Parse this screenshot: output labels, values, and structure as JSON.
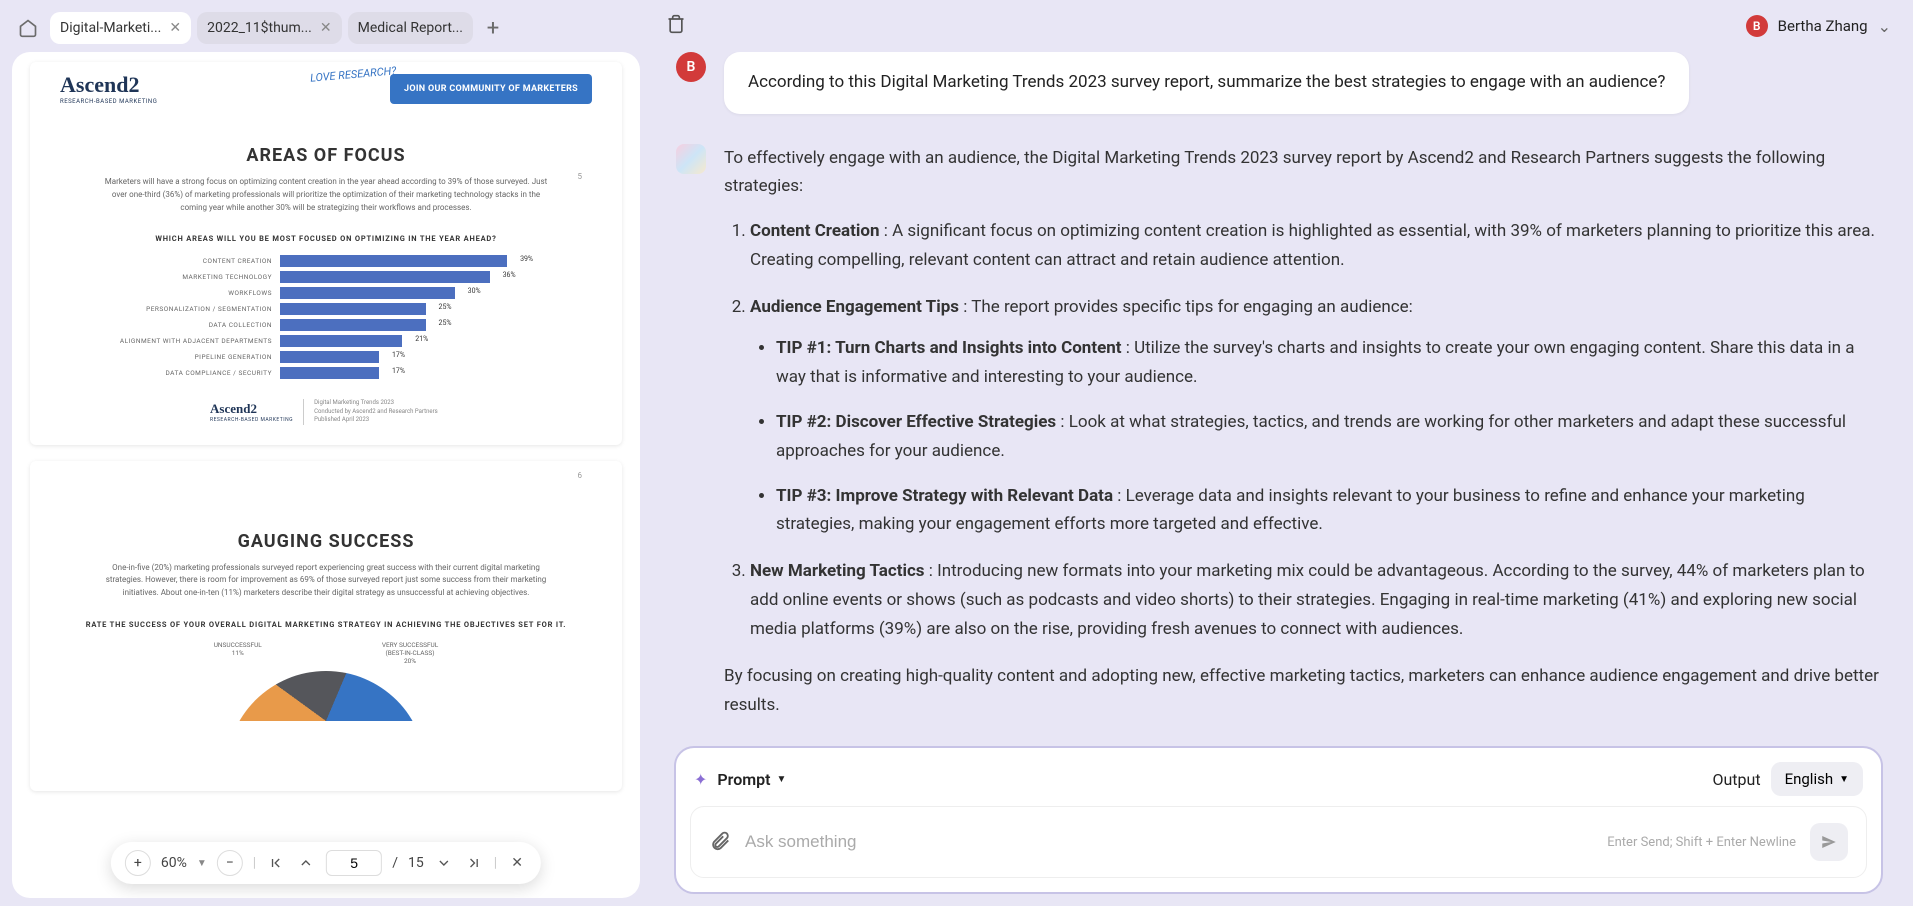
{
  "tabs": [
    {
      "label": "Digital-Marketi...",
      "active": true
    },
    {
      "label": "2022_11$thum...",
      "active": false
    },
    {
      "label": "Medical Report...",
      "active": false
    }
  ],
  "doc": {
    "logo": "Ascend2",
    "logo_sub": "RESEARCH-BASED MARKETING",
    "love": "LOVE RESEARCH?",
    "cta": "JOIN OUR COMMUNITY OF MARKETERS",
    "page5": {
      "num": "5",
      "title": "AREAS OF FOCUS",
      "text": "Marketers will have a strong focus on optimizing content creation in the year ahead according to 39% of those surveyed. Just over one-third (36%) of marketing professionals will prioritize the optimization of their marketing technology stacks in the coming year while another 30% will be strategizing their workflows and processes.",
      "chart_title": "WHICH AREAS WILL YOU BE MOST FOCUSED ON OPTIMIZING IN THE YEAR AHEAD?",
      "footer_lines": [
        "Digital Marketing Trends 2023",
        "Conducted by Ascend2 and Research Partners",
        "Published April 2023"
      ]
    },
    "page6": {
      "num": "6",
      "title": "GAUGING SUCCESS",
      "text": "One-in-five (20%) marketing professionals surveyed report experiencing great success with their current digital marketing strategies. However, there is room for improvement as 69% of those surveyed report just some success from their marketing initiatives. About one-in-ten (11%) marketers describe their digital strategy as unsuccessful at achieving objectives.",
      "chart_title": "RATE THE SUCCESS OF YOUR OVERALL DIGITAL MARKETING STRATEGY IN ACHIEVING THE OBJECTIVES SET FOR IT.",
      "donut_left": "UNSUCCESSFUL\n11%",
      "donut_right": "VERY SUCCESSFUL\n(BEST-IN-CLASS)\n20%"
    }
  },
  "chart_data": {
    "type": "bar",
    "title": "WHICH AREAS WILL YOU BE MOST FOCUSED ON OPTIMIZING IN THE YEAR AHEAD?",
    "categories": [
      "CONTENT CREATION",
      "MARKETING TECHNOLOGY",
      "WORKFLOWS",
      "PERSONALIZATION / SEGMENTATION",
      "DATA COLLECTION",
      "ALIGNMENT WITH ADJACENT DEPARTMENTS",
      "PIPELINE GENERATION",
      "DATA COMPLIANCE / SECURITY"
    ],
    "values": [
      39,
      36,
      30,
      25,
      25,
      21,
      17,
      17
    ],
    "xlabel": "",
    "ylabel": "%",
    "ylim": [
      0,
      45
    ]
  },
  "viewer": {
    "zoom": "60%",
    "page_current": "5",
    "page_sep": "/",
    "page_total": "15"
  },
  "user": {
    "initial": "B",
    "name": "Bertha Zhang"
  },
  "chat": {
    "user_initial": "B",
    "user_msg": "According to this Digital Marketing Trends 2023 survey report, summarize the best strategies to engage with an audience?",
    "ai_intro": "To effectively engage with an audience, the Digital Marketing Trends 2023 survey report by Ascend2 and Research Partners suggests the following strategies:",
    "item1_bold": "Content Creation",
    "item1_text": " : A significant focus on optimizing content creation is highlighted as essential, with 39% of marketers planning to prioritize this area. Creating compelling, relevant content can attract and retain audience attention.",
    "item2_bold": "Audience Engagement Tips",
    "item2_text": " : The report provides specific tips for engaging an audience:",
    "tip1_bold": "TIP #1: Turn Charts and Insights into Content",
    "tip1_text": " : Utilize the survey's charts and insights to create your own engaging content. Share this data in a way that is informative and interesting to your audience.",
    "tip2_bold": "TIP #2: Discover Effective Strategies",
    "tip2_text": " : Look at what strategies, tactics, and trends are working for other marketers and adapt these successful approaches for your audience.",
    "tip3_bold": "TIP #3: Improve Strategy with Relevant Data",
    "tip3_text": " : Leverage data and insights relevant to your business to refine and enhance your marketing strategies, making your engagement efforts more targeted and effective.",
    "item3_bold": "New Marketing Tactics",
    "item3_text": " : Introducing new formats into your marketing mix could be advantageous. According to the survey, 44% of marketers plan to add online events or shows (such as podcasts and video shorts) to their strategies. Engaging in real-time marketing (41%) and exploring new social media platforms (39%) are also on the rise, providing fresh avenues to connect with audiences.",
    "ai_outro": "By focusing on creating high-quality content and adopting new, effective marketing tactics, marketers can enhance audience engagement and drive better results."
  },
  "input": {
    "prompt_label": "Prompt",
    "output_label": "Output",
    "lang": "English",
    "placeholder": "Ask something",
    "hint": "Enter Send; Shift + Enter Newline"
  }
}
